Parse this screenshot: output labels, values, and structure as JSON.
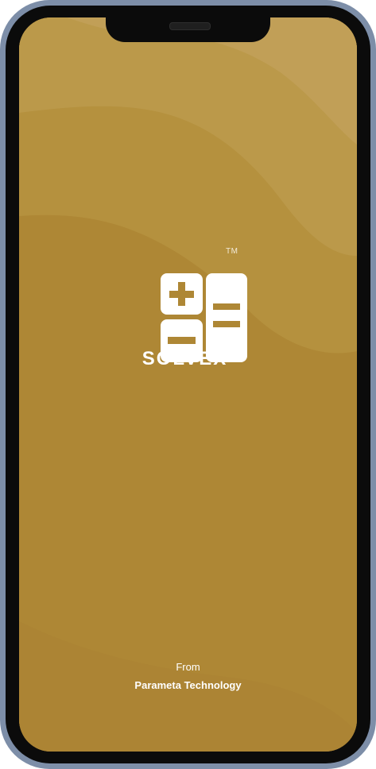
{
  "app": {
    "name": "SOLVEX",
    "trademark": "TM",
    "logo_icon": "calculator-icon"
  },
  "footer": {
    "from_label": "From",
    "company": "Parameta Technology"
  },
  "colors": {
    "background": "#ae8735",
    "wave_light": "#c6a566",
    "frame": "#7d8ea8",
    "text": "#ffffff"
  }
}
